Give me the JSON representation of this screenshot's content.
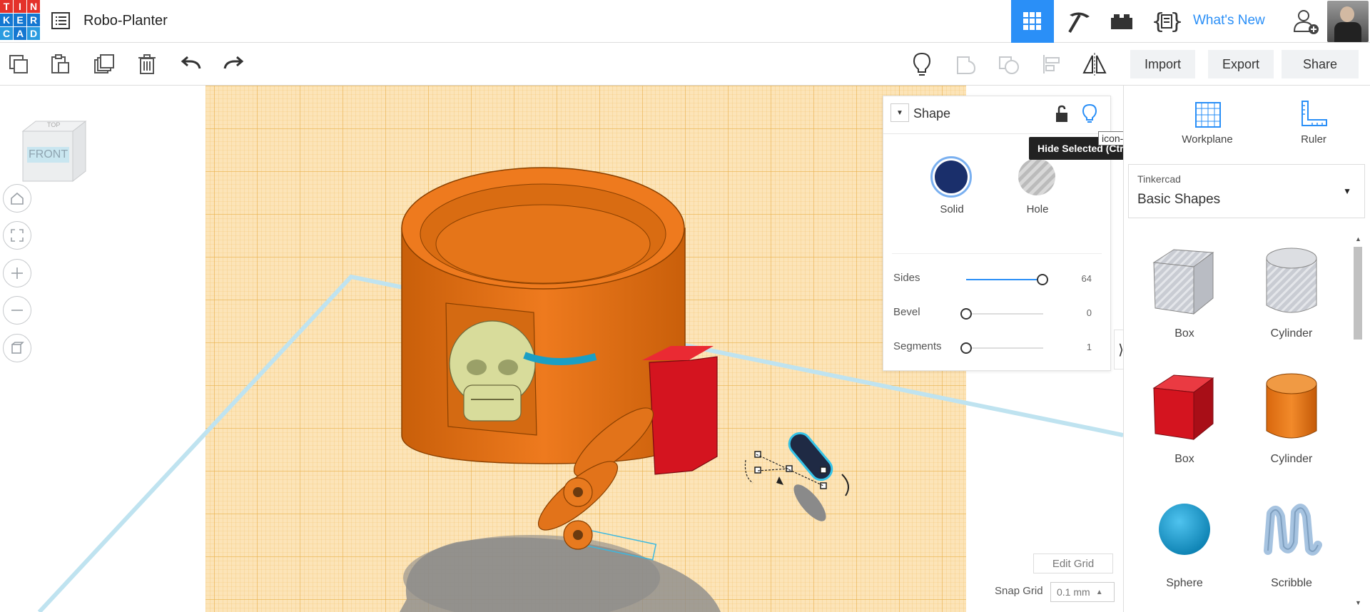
{
  "app": {
    "logo_letters": [
      "T",
      "I",
      "N",
      "K",
      "E",
      "R",
      "C",
      "A",
      "D"
    ],
    "logo_colors": [
      "#e4322b",
      "#e4322b",
      "#e4322b",
      "#1477d1",
      "#1477d1",
      "#1477d1",
      "#2a9be0",
      "#1477d1",
      "#2a9be0"
    ],
    "project_title": "Robo-Planter",
    "whats_new": "What's New"
  },
  "toolbar": {
    "import_label": "Import",
    "export_label": "Export",
    "share_label": "Share"
  },
  "viewcube": {
    "front_label": "FRONT",
    "top_label": "TOP"
  },
  "inspector": {
    "title": "Shape",
    "tooltip_hide": "Hide Selected (Ctrl+H)",
    "tooltip_icon": "icon-object-hidden",
    "solid_label": "Solid",
    "hole_label": "Hole",
    "solid_color": "#1a2f6b",
    "params": [
      {
        "name": "Sides",
        "value": "64",
        "fraction": 1.0
      },
      {
        "name": "Bevel",
        "value": "0",
        "fraction": 0.0
      },
      {
        "name": "Segments",
        "value": "1",
        "fraction": 0.0
      }
    ]
  },
  "grid": {
    "edit_grid_label": "Edit Grid",
    "snap_grid_label": "Snap Grid",
    "snap_grid_value": "0.1 mm"
  },
  "rightpanel": {
    "workplane_label": "Workplane",
    "ruler_label": "Ruler",
    "library_source": "Tinkercad",
    "library_name": "Basic Shapes",
    "shapes": [
      {
        "label": "Box",
        "kind": "box-hole"
      },
      {
        "label": "Cylinder",
        "kind": "cyl-hole"
      },
      {
        "label": "Box",
        "kind": "box-red"
      },
      {
        "label": "Cylinder",
        "kind": "cyl-orange"
      },
      {
        "label": "Sphere",
        "kind": "sphere"
      },
      {
        "label": "Scribble",
        "kind": "scribble"
      }
    ]
  }
}
